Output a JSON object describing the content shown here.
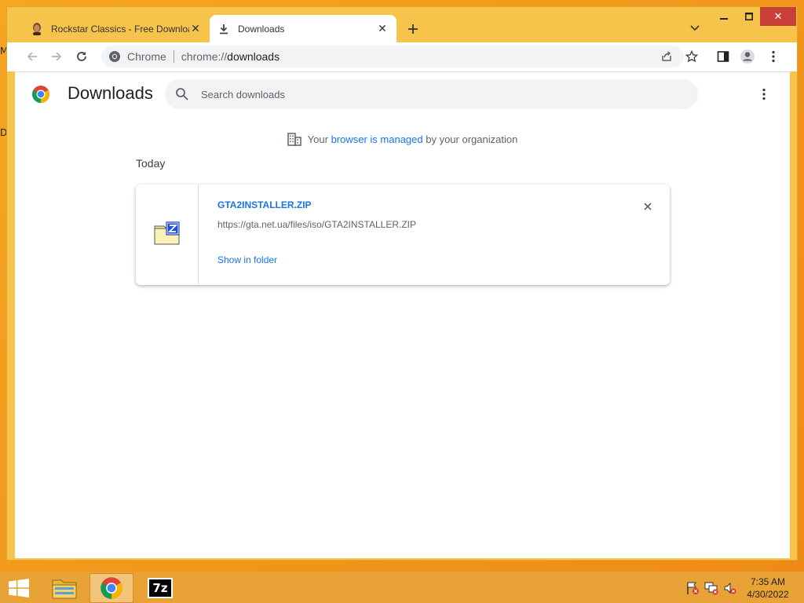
{
  "tabs": [
    {
      "title": "Rockstar Classics - Free Downloa",
      "icon": "person-favicon-icon",
      "active": false
    },
    {
      "title": "Downloads",
      "icon": "download-icon",
      "active": true
    }
  ],
  "window_controls": {
    "minimize": "minimize-icon",
    "maximize": "maximize-icon",
    "close": "close-icon"
  },
  "omnibox": {
    "site_label": "Chrome",
    "url_scheme": "chrome://",
    "url_host": "downloads"
  },
  "page": {
    "title": "Downloads",
    "search_placeholder": "Search downloads",
    "managed_prefix": "Your ",
    "managed_link": "browser is managed",
    "managed_suffix": " by your organization",
    "date_header": "Today"
  },
  "downloads": [
    {
      "filename": "GTA2INSTALLER.ZIP",
      "url": "https://gta.net.ua/files/iso/GTA2INSTALLER.ZIP",
      "action": "Show in folder",
      "icon": "zip-file-icon"
    }
  ],
  "taskbar": {
    "time": "7:35 AM",
    "date": "4/30/2022",
    "apps": [
      "file-explorer",
      "chrome",
      "7-zip"
    ],
    "sevenzip_label": "7z"
  },
  "desktop_glyphs": [
    "M",
    "D"
  ],
  "colors": {
    "accent": "#1a73e8",
    "window_frame": "#f6c34b",
    "taskbar": "#e9a235",
    "close_button": "#c9403a"
  }
}
